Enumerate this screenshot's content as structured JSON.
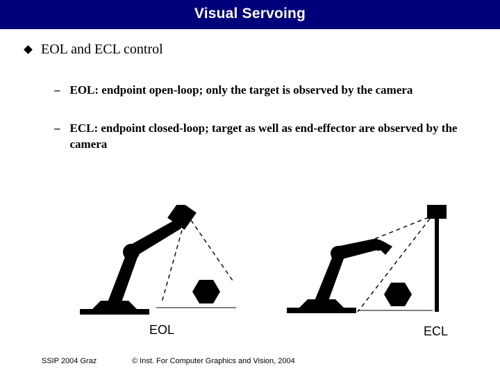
{
  "title": "Visual Servoing",
  "heading": "EOL and ECL control",
  "bullets": [
    "EOL: endpoint open-loop; only the target is observed by the camera",
    "ECL: endpoint closed-loop; target as well as end-effector are observed by the camera"
  ],
  "figure_labels": {
    "left": "EOL",
    "right": "ECL"
  },
  "footer": {
    "left": "SSIP 2004 Graz",
    "center": "© Inst. For Computer Graphics and Vision, 2004"
  }
}
